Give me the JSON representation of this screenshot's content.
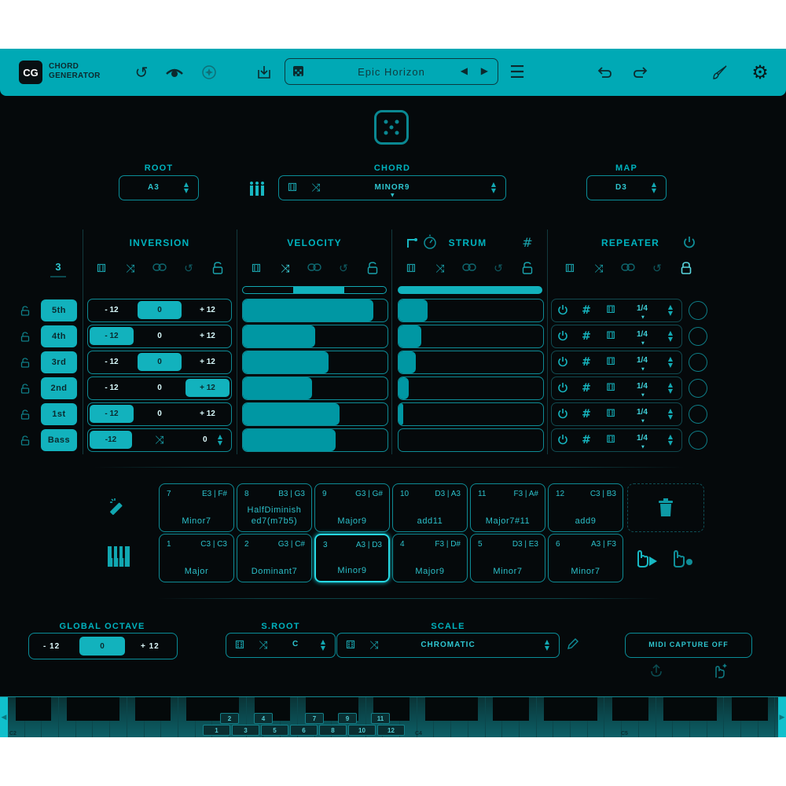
{
  "app": {
    "logo": "CG",
    "title_line1": "CHORD",
    "title_line2": "GENERATOR",
    "preset_name": "Epic Horizon"
  },
  "toolbar": {
    "icons": [
      "reset-icon",
      "morph-icon",
      "target-icon",
      "download-icon",
      "dice-icon",
      "prev-icon",
      "next-icon",
      "menu-icon",
      "undo-icon",
      "redo-icon",
      "brush-icon",
      "gear-icon"
    ]
  },
  "top_controls": {
    "root": {
      "label": "ROOT",
      "value": "A3"
    },
    "chord": {
      "label": "CHORD",
      "value": "MINOR9"
    },
    "map": {
      "label": "MAP",
      "value": "D3"
    }
  },
  "sections": {
    "inversion": "INVERSION",
    "velocity": "VELOCITY",
    "strum": "STRUM",
    "repeater": "REPEATER",
    "voice_count": "3"
  },
  "voices": [
    {
      "label": "5th",
      "inversion": "0",
      "velocity": 0.9,
      "strum": 0.2,
      "rate": "1/4"
    },
    {
      "label": "4th",
      "inversion": "-12",
      "velocity": 0.5,
      "strum": 0.16,
      "rate": "1/4"
    },
    {
      "label": "3rd",
      "inversion": "0",
      "velocity": 0.59,
      "strum": 0.12,
      "rate": "1/4"
    },
    {
      "label": "2nd",
      "inversion": "+12",
      "velocity": 0.48,
      "strum": 0.07,
      "rate": "1/4"
    },
    {
      "label": "1st",
      "inversion": "-12",
      "velocity": 0.67,
      "strum": 0.03,
      "rate": "1/4"
    },
    {
      "label": "Bass",
      "inversion": "-12",
      "velocity": 0.64,
      "strum": 0.0,
      "rate": "1/4",
      "bass_value": "0"
    }
  ],
  "inversion_options": {
    "minus": "- 12",
    "zero": "0",
    "plus": "+ 12",
    "bass_minus": "-12"
  },
  "velocity_master": 0.64,
  "strum_master": 1.0,
  "pads": [
    {
      "num": "7",
      "notes": "E3 | F#",
      "name": "Minor7"
    },
    {
      "num": "8",
      "notes": "B3 | G3",
      "name": "HalfDiminished7(m7b5)"
    },
    {
      "num": "9",
      "notes": "G3 | G#",
      "name": "Major9"
    },
    {
      "num": "10",
      "notes": "D3 | A3",
      "name": "add11"
    },
    {
      "num": "11",
      "notes": "F3 | A#",
      "name": "Major7#11"
    },
    {
      "num": "12",
      "notes": "C3 | B3",
      "name": "add9"
    },
    {
      "num": "1",
      "notes": "C3 | C3",
      "name": "Major"
    },
    {
      "num": "2",
      "notes": "G3 | C#",
      "name": "Dominant7"
    },
    {
      "num": "3",
      "notes": "A3 | D3",
      "name": "Minor9",
      "selected": true
    },
    {
      "num": "4",
      "notes": "F3 | D#",
      "name": "Major9"
    },
    {
      "num": "5",
      "notes": "D3 | E3",
      "name": "Minor7"
    },
    {
      "num": "6",
      "notes": "A3 | F3",
      "name": "Minor7"
    }
  ],
  "bottom": {
    "global_octave": {
      "label": "GLOBAL OCTAVE",
      "minus": "- 12",
      "value": "0",
      "plus": "+ 12"
    },
    "sroot": {
      "label": "S.ROOT",
      "value": "C"
    },
    "scale": {
      "label": "SCALE",
      "value": "CHROMATIC"
    },
    "midi_capture": "MIDI CAPTURE OFF"
  },
  "keyboard": {
    "labels": [
      "C2",
      "C4",
      "C5"
    ],
    "upper_nums": [
      "2",
      "4",
      "7",
      "9",
      "11"
    ],
    "lower_nums": [
      "1",
      "3",
      "5",
      "6",
      "8",
      "10",
      "12"
    ]
  }
}
